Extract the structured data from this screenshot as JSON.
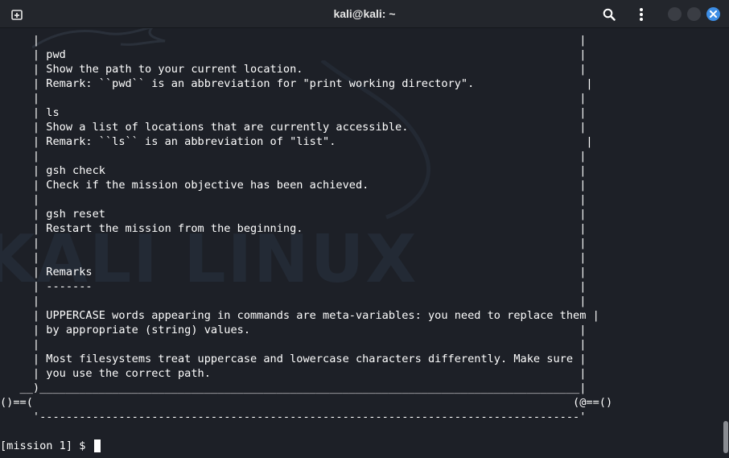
{
  "window": {
    "title": "kali@kali: ~"
  },
  "titlebar": {
    "icons": [
      "new-tab-icon",
      "search-icon",
      "menu-icon",
      "minimize",
      "maximize",
      "close-icon"
    ],
    "accent_close": "#3d8ee6"
  },
  "background": {
    "watermark": "KALI LINUX"
  },
  "terminal": {
    "lines": [
      "     |                                                                                  |",
      "     | pwd                                                                              |",
      "     | Show the path to your current location.                                          |",
      "     | Remark: ``pwd`` is an abbreviation for \"print working directory\".                 |",
      "     |                                                                                  |",
      "     | ls                                                                               |",
      "     | Show a list of locations that are currently accessible.                          |",
      "     | Remark: ``ls`` is an abbreviation of \"list\".                                      |",
      "     |                                                                                  |",
      "     | gsh check                                                                        |",
      "     | Check if the mission objective has been achieved.                                |",
      "     |                                                                                  |",
      "     | gsh reset                                                                        |",
      "     | Restart the mission from the beginning.                                          |",
      "     |                                                                                  |",
      "     |                                                                                  |",
      "     | Remarks                                                                          |",
      "     | -------                                                                          |",
      "     |                                                                                  |",
      "     | UPPERCASE words appearing in commands are meta-variables: you need to replace them |",
      "     | by appropriate (string) values.                                                  |",
      "     |                                                                                  |",
      "     | Most filesystems treat uppercase and lowercase characters differently. Make sure |",
      "     | you use the correct path.                                                        |",
      "   __)__________________________________________________________________________________|",
      "()==(                                                                                  (@==()",
      "     '----------------------------------------------------------------------------------'"
    ],
    "prompt": "[mission 1] $ "
  }
}
